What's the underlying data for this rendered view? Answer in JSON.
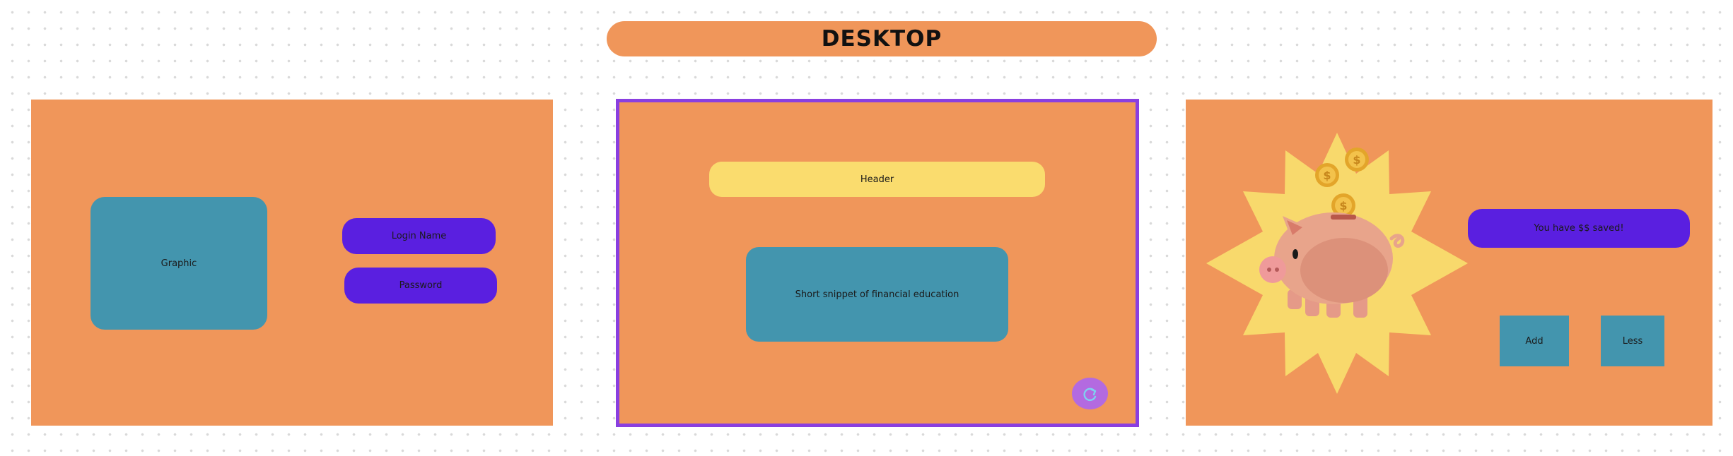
{
  "title": "DESKTOP",
  "colors": {
    "frame_orange": "#f0965a",
    "teal": "#4395ae",
    "purple": "#5a1fe0",
    "yellow": "#fadc6e",
    "selection_border": "#8a3fe0"
  },
  "login_screen": {
    "graphic_label": "Graphic",
    "login_name_label": "Login Name",
    "password_label": "Password"
  },
  "education_screen": {
    "header_label": "Header",
    "snippet_label": "Short snippet of financial education",
    "refresh_icon": "refresh-arrow-icon"
  },
  "savings_screen": {
    "illustration": "piggy-bank-with-coins",
    "saved_label": "You have $$ saved!",
    "add_label": "Add",
    "less_label": "Less"
  }
}
